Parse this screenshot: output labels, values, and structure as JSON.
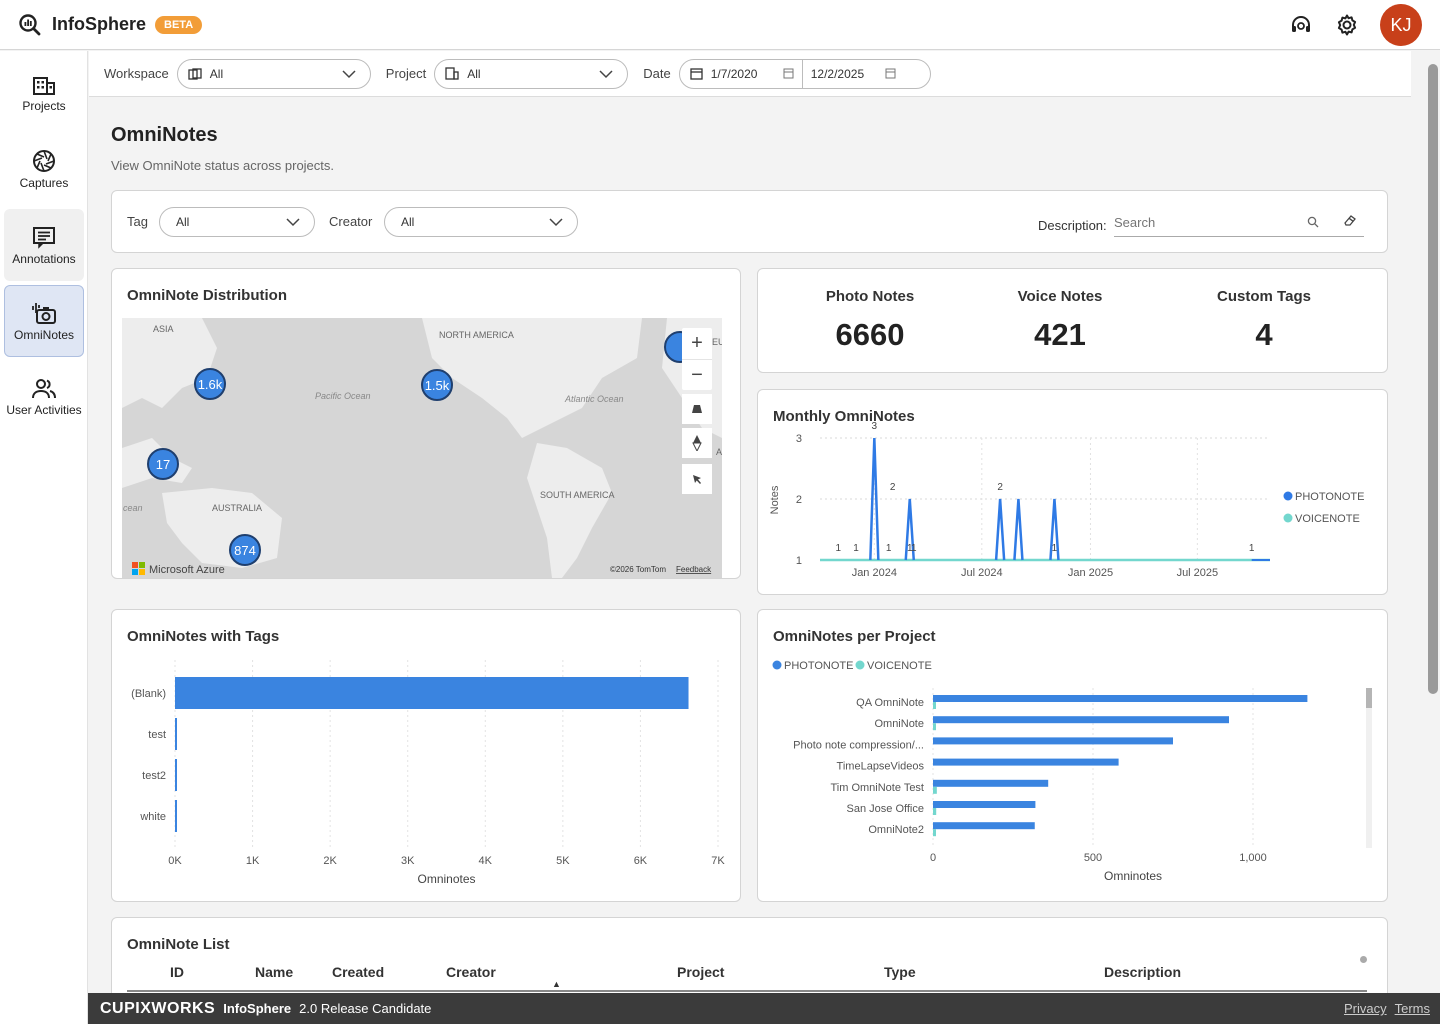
{
  "app": {
    "name": "InfoSphere",
    "badge": "BETA",
    "avatar_initials": "KJ",
    "accent": "#2f7ae5",
    "avatar_color": "#c8401a"
  },
  "sidebar": {
    "items": [
      {
        "label": "Projects",
        "icon": "building-icon"
      },
      {
        "label": "Captures",
        "icon": "aperture-icon"
      },
      {
        "label": "Annotations",
        "icon": "annotation-icon"
      },
      {
        "label": "OmniNotes",
        "icon": "camera-note-icon"
      },
      {
        "label": "User Activities",
        "icon": "users-icon"
      }
    ],
    "active": "OmniNotes"
  },
  "filters": {
    "workspace_label": "Workspace",
    "workspace_value": "All",
    "project_label": "Project",
    "project_value": "All",
    "date_label": "Date",
    "date_from": "1/7/2020",
    "date_to": "12/2/2025"
  },
  "page": {
    "title": "OmniNotes",
    "subtitle": "View OmniNote status across projects."
  },
  "subfilters": {
    "tag_label": "Tag",
    "tag_value": "All",
    "creator_label": "Creator",
    "creator_value": "All",
    "description_label": "Description:",
    "search_placeholder": "Search"
  },
  "map": {
    "title": "OmniNote Distribution",
    "labels": {
      "asia": "ASIA",
      "north_america": "NORTH AMERICA",
      "pacific": "Pacific Ocean",
      "atlantic": "Atlantic Ocean",
      "south_america": "SOUTH AMERICA",
      "australia": "AUSTRALIA",
      "ocean_left": "cean",
      "eu": "EU",
      "af": "A"
    },
    "clusters": [
      "1.6k",
      "1.5k",
      "17",
      "874"
    ],
    "attribution": "Microsoft Azure",
    "copyright": "©2026 TomTom",
    "feedback": "Feedback"
  },
  "kpis": [
    {
      "label": "Photo Notes",
      "value": "6660"
    },
    {
      "label": "Voice Notes",
      "value": "421"
    },
    {
      "label": "Custom Tags",
      "value": "4"
    }
  ],
  "monthly": {
    "title": "Monthly OmniNotes",
    "chart_data": {
      "type": "line",
      "ylabel": "Notes",
      "ylim": [
        1,
        3
      ],
      "yticks": [
        "1",
        "2",
        "3"
      ],
      "xticks": [
        "Jan 2024",
        "Jul 2024",
        "Jan 2025",
        "Jul 2025"
      ],
      "series": [
        {
          "name": "PHOTONOTE",
          "color": "#2f7ae5",
          "x": [
            "2023-11",
            "2023-12",
            "2024-01",
            "2024-02",
            "2024-03",
            "2024-08",
            "2024-09",
            "2024-11",
            "2025-10"
          ],
          "values": [
            1,
            1,
            3,
            1,
            2,
            2,
            2,
            2,
            1
          ]
        },
        {
          "name": "VOICENOTE",
          "color": "#73d7ce",
          "x": [
            "2024-01",
            "2024-02",
            "2024-03"
          ],
          "values": [
            1,
            1,
            1
          ]
        }
      ],
      "data_labels": [
        "1",
        "1",
        "3",
        "2",
        "1",
        "1",
        "1",
        "2",
        "1",
        "1"
      ],
      "legend": "right"
    }
  },
  "tags": {
    "title": "OmniNotes with Tags",
    "chart_data": {
      "type": "bar",
      "orientation": "horizontal",
      "categories": [
        "(Blank)",
        "test",
        "test2",
        "white"
      ],
      "values": [
        6620,
        10,
        10,
        10
      ],
      "xlabel": "Omninotes",
      "xticks": [
        "0K",
        "1K",
        "2K",
        "3K",
        "4K",
        "5K",
        "6K",
        "7K"
      ],
      "xlim": [
        0,
        7000
      ],
      "color": "#3a84e0"
    }
  },
  "per_project": {
    "title": "OmniNotes per Project",
    "chart_data": {
      "type": "bar",
      "orientation": "horizontal",
      "categories": [
        "QA OmniNote",
        "OmniNote",
        "Photo note compression/...",
        "TimeLapseVideos",
        "Tim OmniNote Test",
        "San Jose Office",
        "OmniNote2"
      ],
      "series": [
        {
          "name": "PHOTONOTE",
          "color": "#3a84e0",
          "values": [
            1170,
            925,
            750,
            580,
            360,
            320,
            318
          ]
        },
        {
          "name": "VOICENOTE",
          "color": "#73d7ce",
          "values": [
            8,
            8,
            0,
            0,
            12,
            10,
            8
          ]
        }
      ],
      "xlabel": "Omninotes",
      "xticks": [
        "0",
        "500",
        "1,000"
      ],
      "xlim": [
        0,
        1250
      ],
      "legend": "top-left"
    }
  },
  "list": {
    "title": "OmniNote List",
    "columns": [
      "ID",
      "Name",
      "Created",
      "Creator",
      "Project",
      "Type",
      "Description"
    ]
  },
  "footer": {
    "brand": "CUPIXWORKS",
    "product": "InfoSphere",
    "version": "2.0 Release Candidate",
    "privacy": "Privacy",
    "terms": "Terms"
  }
}
